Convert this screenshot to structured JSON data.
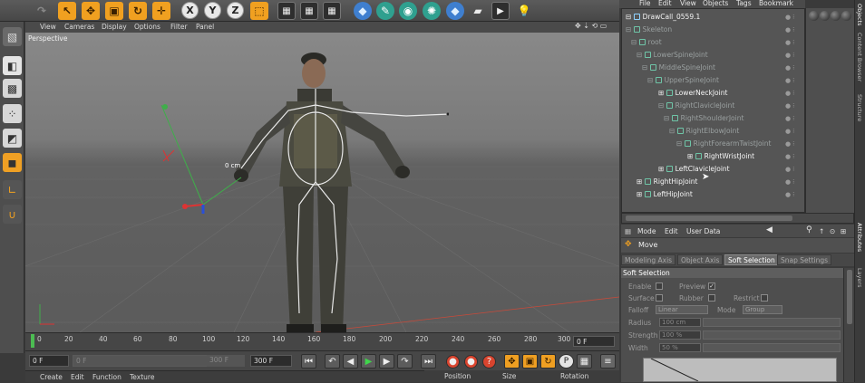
{
  "toolbar": {
    "undo_icon": "undo-icon",
    "x_label": "X",
    "y_label": "Y",
    "z_label": "Z"
  },
  "viewport": {
    "menu": [
      "View",
      "Cameras",
      "Display",
      "Options",
      "Filter",
      "Panel"
    ],
    "label": "Perspective",
    "measure": "0 cm"
  },
  "object_manager": {
    "menu": [
      "File",
      "Edit",
      "View",
      "Objects",
      "Tags",
      "Bookmark"
    ],
    "items": [
      {
        "label": "DrawCall_0559.1",
        "style": "bright"
      },
      {
        "label": "Skeleton",
        "style": "dim"
      },
      {
        "label": "root",
        "style": "dim"
      },
      {
        "label": "LowerSpineJoint",
        "style": "dim"
      },
      {
        "label": "MiddleSpineJoint",
        "style": "dim"
      },
      {
        "label": "UpperSpineJoint",
        "style": "dim"
      },
      {
        "label": "LowerNeckJoint",
        "style": "bright"
      },
      {
        "label": "RightClavicleJoint",
        "style": "dim"
      },
      {
        "label": "RightShoulderJoint",
        "style": "dim"
      },
      {
        "label": "RightElbowJoint",
        "style": "dim"
      },
      {
        "label": "RightForearmTwistJoint",
        "style": "dim"
      },
      {
        "label": "RightWristJoint",
        "style": "bright"
      },
      {
        "label": "LeftClavicleJoint",
        "style": "bright"
      },
      {
        "label": "RightHipJoint",
        "style": "bright"
      },
      {
        "label": "LeftHipJoint",
        "style": "bright"
      }
    ]
  },
  "side_tabs": [
    "Objects",
    "Content Browser",
    "Structure",
    "Attributes",
    "Layers"
  ],
  "timeline": {
    "ticks": [
      "0",
      "20",
      "40",
      "60",
      "80",
      "100",
      "120",
      "140",
      "160",
      "180",
      "200",
      "220",
      "240",
      "260",
      "280",
      "300"
    ],
    "current_frame": "0 F"
  },
  "transport": {
    "start_frame": "0 F",
    "range_field": "0 F",
    "range_end": "300 F",
    "end_frame": "300 F"
  },
  "material_bar": {
    "menu": [
      "Create",
      "Edit",
      "Function",
      "Texture"
    ]
  },
  "coordinates": {
    "headers": [
      "Position",
      "Size",
      "Rotation"
    ]
  },
  "attributes": {
    "menu": [
      "Mode",
      "Edit",
      "User Data"
    ],
    "title": "Move",
    "tabs": [
      "Modeling Axis",
      "Object Axis",
      "Soft Selection",
      "Snap Settings"
    ],
    "active_tab": "Soft Selection",
    "section": "Soft Selection",
    "enable_label": "Enable",
    "preview_label": "Preview",
    "surface_label": "Surface",
    "rubber_label": "Rubber",
    "restrict_label": "Restrict",
    "falloff_label": "Falloff",
    "falloff_value": "Linear",
    "mode_label": "Mode",
    "mode_value": "Group",
    "radius_label": "Radius",
    "radius_value": "100 cm",
    "strength_label": "Strength",
    "strength_value": "100 %",
    "width_label": "Width",
    "width_value": "50 %"
  }
}
